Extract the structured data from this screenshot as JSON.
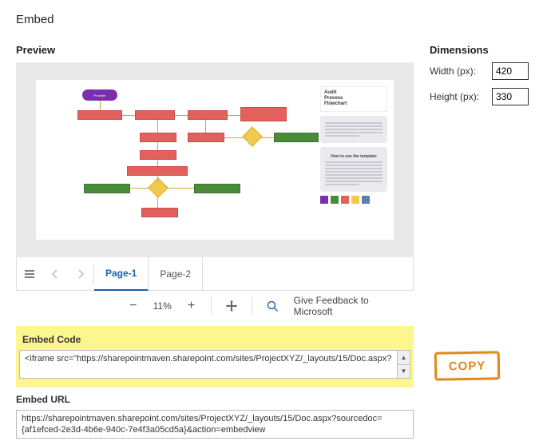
{
  "title": "Embed",
  "preview_label": "Preview",
  "dimensions": {
    "heading": "Dimensions",
    "width_label": "Width (px):",
    "width_value": "420",
    "height_label": "Height (px):",
    "height_value": "330"
  },
  "diagram": {
    "provider": "Provider",
    "sidebar_title": "Audit\nProcess\nFlowchart",
    "sidebar_sub": "How to use the template"
  },
  "viewer": {
    "tabs": [
      "Page-1",
      "Page-2"
    ],
    "active_tab": 0,
    "zoom": "11%",
    "feedback": "Give Feedback to Microsoft"
  },
  "embed_code": {
    "label": "Embed Code",
    "value": "<iframe src=\"https://sharepointmaven.sharepoint.com/sites/ProjectXYZ/_layouts/15/Doc.aspx?"
  },
  "embed_url": {
    "label": "Embed URL",
    "value": "https://sharepointmaven.sharepoint.com/sites/ProjectXYZ/_layouts/15/Doc.aspx?sourcedoc={af1efced-2e3d-4b6e-940c-7e4f3a05cd5a}&action=embedview"
  },
  "copy_stamp": "COPY"
}
